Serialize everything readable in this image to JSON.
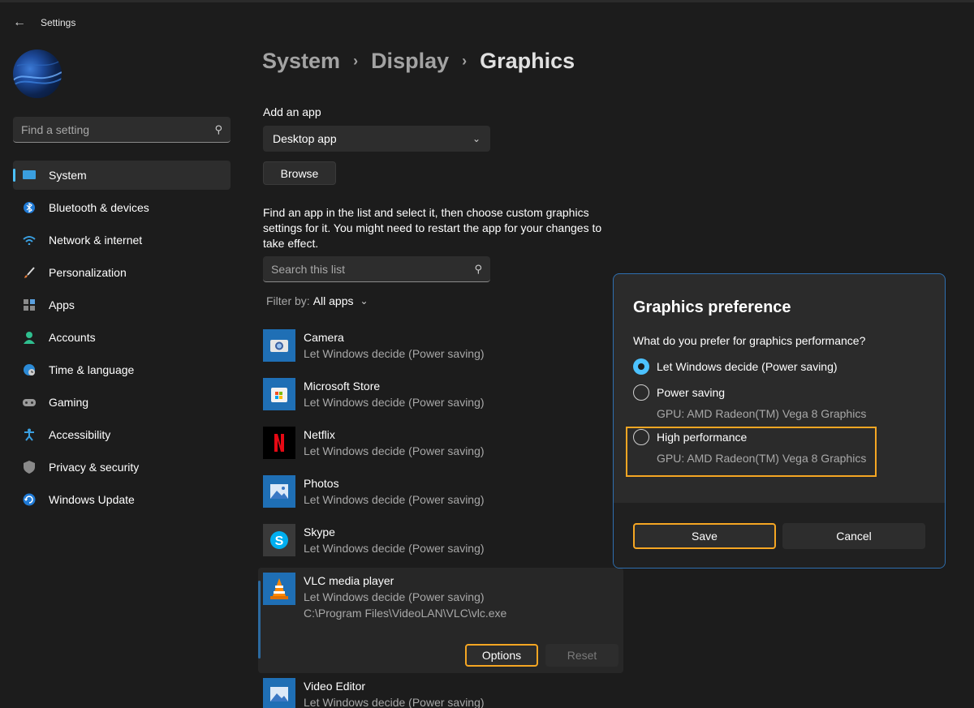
{
  "window": {
    "title": "Settings"
  },
  "search": {
    "placeholder": "Find a setting"
  },
  "sidebar": {
    "items": [
      {
        "label": "System",
        "icon": "system-icon",
        "selected": true
      },
      {
        "label": "Bluetooth & devices",
        "icon": "bluetooth-icon"
      },
      {
        "label": "Network & internet",
        "icon": "wifi-icon"
      },
      {
        "label": "Personalization",
        "icon": "brush-icon"
      },
      {
        "label": "Apps",
        "icon": "apps-icon"
      },
      {
        "label": "Accounts",
        "icon": "account-icon"
      },
      {
        "label": "Time & language",
        "icon": "globe-clock-icon"
      },
      {
        "label": "Gaming",
        "icon": "gamepad-icon"
      },
      {
        "label": "Accessibility",
        "icon": "accessibility-icon"
      },
      {
        "label": "Privacy & security",
        "icon": "shield-icon"
      },
      {
        "label": "Windows Update",
        "icon": "update-icon"
      }
    ]
  },
  "breadcrumb": {
    "items": [
      "System",
      "Display",
      "Graphics"
    ],
    "separator": "›"
  },
  "main": {
    "add_app_label": "Add an app",
    "app_type_value": "Desktop app",
    "browse_label": "Browse",
    "description": "Find an app in the list and select it, then choose custom graphics settings for it. You might need to restart the app for your changes to take effect.",
    "search_list_placeholder": "Search this list",
    "filter_label": "Filter by:",
    "filter_value": "All apps"
  },
  "apps": [
    {
      "name": "Camera",
      "preference": "Let Windows decide (Power saving)",
      "icon": "camera-icon"
    },
    {
      "name": "Microsoft Store",
      "preference": "Let Windows decide (Power saving)",
      "icon": "store-icon"
    },
    {
      "name": "Netflix",
      "preference": "Let Windows decide (Power saving)",
      "icon": "netflix-icon"
    },
    {
      "name": "Photos",
      "preference": "Let Windows decide (Power saving)",
      "icon": "photos-icon"
    },
    {
      "name": "Skype",
      "preference": "Let Windows decide (Power saving)",
      "icon": "skype-icon"
    },
    {
      "name": "VLC media player",
      "preference": "Let Windows decide (Power saving)",
      "path": "C:\\Program Files\\VideoLAN\\VLC\\vlc.exe",
      "icon": "vlc-icon",
      "options_label": "Options",
      "reset_label": "Reset"
    },
    {
      "name": "Video Editor",
      "preference": "Let Windows decide (Power saving)",
      "icon": "video-editor-icon"
    }
  ],
  "dialog": {
    "title": "Graphics preference",
    "question": "What do you prefer for graphics performance?",
    "options": [
      {
        "label": "Let Windows decide (Power saving)",
        "checked": true
      },
      {
        "label": "Power saving",
        "gpu": "GPU: AMD Radeon(TM) Vega 8 Graphics",
        "checked": false
      },
      {
        "label": "High performance",
        "gpu": "GPU: AMD Radeon(TM) Vega 8 Graphics",
        "checked": false
      }
    ],
    "save_label": "Save",
    "cancel_label": "Cancel"
  },
  "colors": {
    "accent": "#4cc2ff",
    "highlight": "#f5a623",
    "background": "#1c1c1c"
  }
}
